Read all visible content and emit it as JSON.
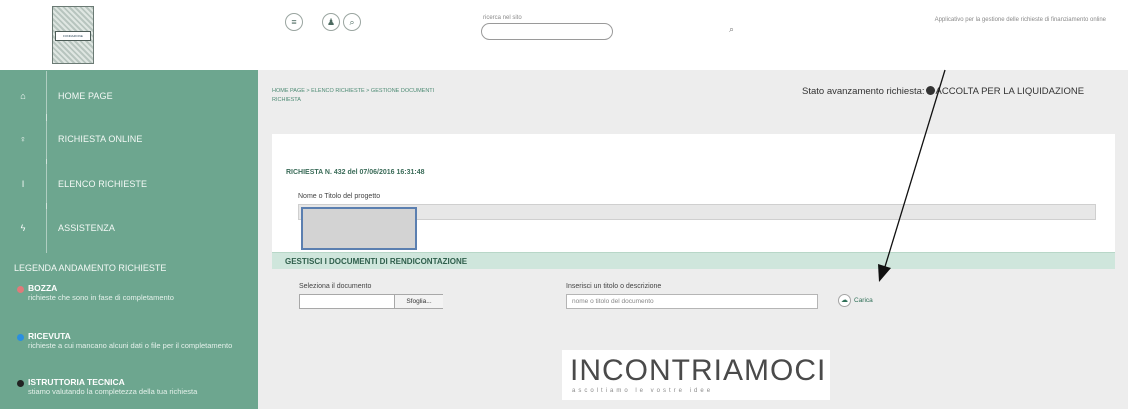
{
  "header": {
    "logo_text": "FONDAZIONE",
    "search_label": "ricerca nel sito",
    "tagline": "Applicativo per la gestione delle richieste di finanziamento online",
    "icons": [
      "menu-icon",
      "user-icon",
      "search-icon"
    ]
  },
  "sidebar": {
    "items": [
      {
        "label": "HOME PAGE",
        "icon": "home-icon"
      },
      {
        "label": "RICHIESTA ONLINE",
        "icon": "bulb-icon"
      },
      {
        "label": "ELENCO RICHIESTE",
        "icon": "info-icon"
      },
      {
        "label": "ASSISTENZA",
        "icon": "bolt-icon"
      }
    ],
    "legend_title": "LEGENDA ANDAMENTO RICHIESTE",
    "legend": [
      {
        "name": "BOZZA",
        "desc": "richieste che sono in fase di completamento",
        "color": "#e07a7a"
      },
      {
        "name": "RICEVUTA",
        "desc": "richieste a cui mancano alcuni dati o file per il completamento",
        "color": "#2a8fe0"
      },
      {
        "name": "ISTRUTTORIA TECNICA",
        "desc": "stiamo valutando la completezza della tua richiesta",
        "color": "#222222"
      }
    ]
  },
  "main": {
    "breadcrumb": "HOME PAGE  >  ELENCO RICHIESTE  >  GESTIONE DOCUMENTI",
    "breadcrumb_sub": "RICHIESTA",
    "stato_label": "Stato avanzamento richiesta:",
    "stato_value": "ACCOLTA PER LA LIQUIDAZIONE",
    "request_title": "RICHIESTA N. 432 del 07/06/2016 16:31:48",
    "project_label": "Nome o Titolo del progetto",
    "section_title": "GESTISCI I DOCUMENTI DI RENDICONTAZIONE",
    "select_doc_label": "Seleziona il documento",
    "browse_label": "Sfoglia...",
    "title_desc_label": "Inserisci un titolo o descrizione",
    "title_desc_placeholder": "nome o titolo del documento",
    "upload_label": "Carica"
  },
  "brand": {
    "word": "INCONTRIAMOCI",
    "sub": "ascoltiamo le vostre idee"
  },
  "colors": {
    "sidebar": "#6da68f",
    "accent": "#2f6f57",
    "section_bar": "#cfe6dc"
  }
}
